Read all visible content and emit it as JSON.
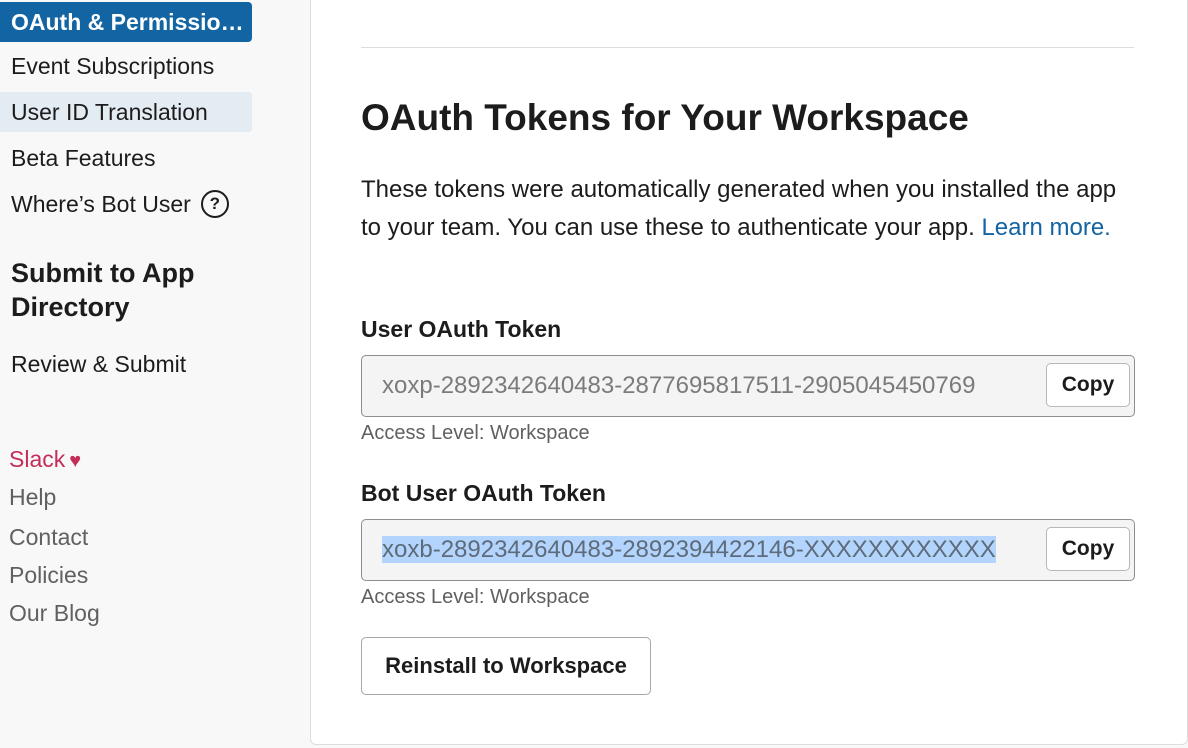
{
  "sidebar": {
    "items": [
      {
        "label": "OAuth & Permissio…",
        "state": "active"
      },
      {
        "label": "Event Subscriptions"
      },
      {
        "label": "User ID Translation",
        "state": "hover"
      },
      {
        "label": "Beta Features"
      },
      {
        "label": "Where’s Bot User",
        "icon": "help-icon",
        "icon_glyph": "?"
      }
    ],
    "section_heading": "Submit to App Directory",
    "section_items": [
      {
        "label": "Review & Submit"
      }
    ],
    "footer": {
      "slack": "Slack",
      "heart": "♥",
      "links": [
        "Help",
        "Contact",
        "Policies",
        "Our Blog"
      ]
    }
  },
  "main": {
    "title": "OAuth Tokens for Your Workspace",
    "description": "These tokens were automatically generated when you installed the app to your team. You can use these to authenticate your app.",
    "learn_more": "Learn more.",
    "user_token": {
      "label": "User OAuth Token",
      "value": "xoxp-2892342640483-2877695817511-2905045450769",
      "copy": "Copy",
      "access": "Access Level: Workspace"
    },
    "bot_token": {
      "label": "Bot User OAuth Token",
      "value": "xoxb-2892342640483-2892394422146-XXXXXXXXXXXX",
      "copy": "Copy",
      "access": "Access Level: Workspace"
    },
    "reinstall": "Reinstall to Workspace"
  },
  "colors": {
    "accent": "#1264a3",
    "selection": "#b3d4fc",
    "slack_pink": "#c52d59"
  }
}
